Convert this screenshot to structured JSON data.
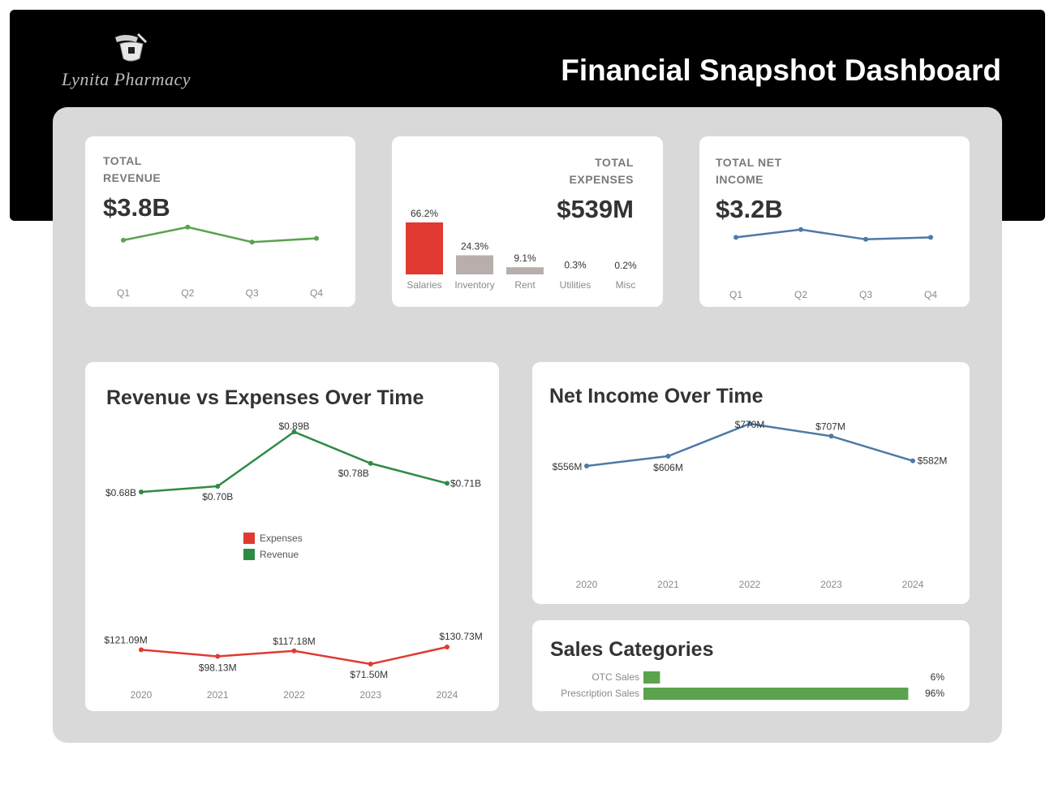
{
  "brand": {
    "name": "Lynita Pharmacy"
  },
  "title": "Financial Snapshot Dashboard",
  "colors": {
    "revenue": "#5ba34f",
    "expenses": "#e03a32",
    "net": "#4e79a7",
    "gray": "#b8aeab",
    "revGreen": "#2e8b45"
  },
  "kpis": {
    "revenue": {
      "label_line1": "TOTAL",
      "label_line2": "REVENUE",
      "value": "$3.8B"
    },
    "expenses": {
      "label_line1": "TOTAL",
      "label_line2": "EXPENSES",
      "value": "$539M"
    },
    "net": {
      "label_line1": "TOTAL NET",
      "label_line2": "INCOME",
      "value": "$3.2B"
    }
  },
  "charts": {
    "rev_vs_exp_title": "Revenue vs Expenses Over Time",
    "net_income_title": "Net Income Over Time",
    "sales_title": "Sales Categories",
    "legend": {
      "expenses": "Expenses",
      "revenue": "Revenue"
    }
  },
  "chart_data": [
    {
      "id": "revenue_quarterly",
      "type": "line",
      "x": [
        "Q1",
        "Q2",
        "Q3",
        "Q4"
      ],
      "series": [
        {
          "values": [
            0.92,
            0.99,
            0.91,
            0.93
          ]
        }
      ]
    },
    {
      "id": "expenses_breakdown",
      "type": "bar",
      "categories": [
        "Salaries",
        "Inventory",
        "Rent",
        "Utilities",
        "Misc"
      ],
      "values": [
        66.2,
        24.3,
        9.1,
        0.3,
        0.2
      ],
      "labels": [
        "66.2%",
        "24.3%",
        "9.1%",
        "0.3%",
        "0.2%"
      ]
    },
    {
      "id": "net_income_quarterly",
      "type": "line",
      "x": [
        "Q1",
        "Q2",
        "Q3",
        "Q4"
      ],
      "series": [
        {
          "values": [
            0.79,
            0.83,
            0.78,
            0.79
          ]
        }
      ]
    },
    {
      "id": "revenue_vs_expenses",
      "type": "line",
      "title": "Revenue vs Expenses Over Time",
      "x": [
        "2020",
        "2021",
        "2022",
        "2023",
        "2024"
      ],
      "series": [
        {
          "name": "Revenue",
          "values": [
            0.68,
            0.7,
            0.89,
            0.78,
            0.71
          ],
          "labels": [
            "$0.68B",
            "$0.70B",
            "$0.89B",
            "$0.78B",
            "$0.71B"
          ]
        },
        {
          "name": "Expenses",
          "values": [
            121.09,
            98.13,
            117.18,
            71.5,
            130.73
          ],
          "labels": [
            "$121.09M",
            "$98.13M",
            "$117.18M",
            "$71.50M",
            "$130.73M"
          ]
        }
      ]
    },
    {
      "id": "net_income_over_time",
      "type": "line",
      "title": "Net Income Over Time",
      "x": [
        "2020",
        "2021",
        "2022",
        "2023",
        "2024"
      ],
      "series": [
        {
          "values": [
            556,
            606,
            770,
            707,
            582
          ],
          "labels": [
            "$556M",
            "$606M",
            "$770M",
            "$707M",
            "$582M"
          ]
        }
      ]
    },
    {
      "id": "sales_categories",
      "type": "bar",
      "title": "Sales Categories",
      "categories": [
        "OTC Sales",
        "Prescription Sales"
      ],
      "values": [
        6,
        96
      ],
      "labels": [
        "6%",
        "96%"
      ]
    }
  ]
}
